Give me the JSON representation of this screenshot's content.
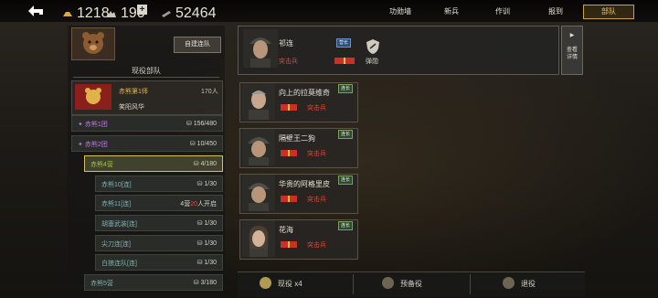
{
  "topbar": {
    "resources": [
      {
        "icon": "gold-bars-icon",
        "value": "1218"
      },
      {
        "icon": "mountain-icon",
        "value": "190"
      },
      {
        "icon": "ammo-icon",
        "value": "52464"
      }
    ],
    "nav": [
      "功勋墙",
      "新兵",
      "作训",
      "报到",
      "部队"
    ],
    "active_nav": "部队"
  },
  "left": {
    "create_button": "自建连队",
    "section_title": "现役部队",
    "division": {
      "name": "赤熊第1师",
      "count": "170人",
      "motto": "笑阳风华"
    },
    "rows": [
      {
        "label": "赤熊1团",
        "value": "156/480"
      },
      {
        "label": "赤熊2团",
        "value": "10/450"
      },
      {
        "label": "赤熊4营",
        "value": "4/180"
      },
      {
        "label": "赤熊10[连]",
        "value": "1/30"
      },
      {
        "label": "赤熊11[连]",
        "value_prefix": "4营",
        "value_highlight": "20",
        "value_suffix": "人开启"
      },
      {
        "label": "胡塞武装[连]",
        "value": "1/30"
      },
      {
        "label": "尖刀连[连]",
        "value": "1/30"
      },
      {
        "label": "白狼连队[连]",
        "value": "1/30"
      },
      {
        "label": "赤熊5营",
        "value": "3/180"
      }
    ]
  },
  "leader": {
    "name": "祁连",
    "rank": "营长",
    "role": "突击兵",
    "medal_label": "弹勋",
    "expand_label": "查看详情"
  },
  "members": [
    {
      "name": "向上的拉莫维奇",
      "rank": "连长",
      "role": "突击兵"
    },
    {
      "name": "隔壁王二狗",
      "rank": "连长",
      "role": "突击兵"
    },
    {
      "name": "华贵的阿格里皮",
      "rank": "连长",
      "role": "突击兵"
    },
    {
      "name": "花海",
      "rank": "连长",
      "role": "突击兵"
    }
  ],
  "tabs": [
    {
      "label": "现役 x4"
    },
    {
      "label": "预备役"
    },
    {
      "label": "退役"
    }
  ],
  "colors": {
    "accent_gold": "#f0c85a",
    "role_red": "#d94a3b",
    "purple": "#c07adf",
    "green": "#9dc24c"
  }
}
